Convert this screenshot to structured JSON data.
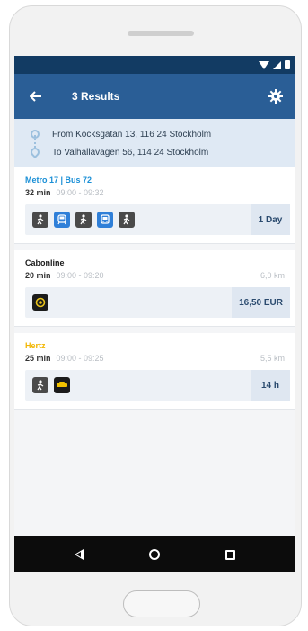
{
  "header": {
    "title": "3 Results"
  },
  "route": {
    "from": "From Kocksgatan 13, 116 24 Stockholm",
    "to": "To Valhallavägen 56, 114 24 Stockholm"
  },
  "results": [
    {
      "provider": "Metro 17 | Bus 72",
      "provider_color": "#1a8fd6",
      "duration": "32 min",
      "times": "09:00 - 09:32",
      "distance": "",
      "modes": [
        "walk-icon",
        "train-icon",
        "walk-icon",
        "bus-icon",
        "walk-icon"
      ],
      "price": "1 Day"
    },
    {
      "provider": "Cabonline",
      "provider_color": "#1b1b1b",
      "duration": "20 min",
      "times": "09:00 - 09:20",
      "distance": "6,0 km",
      "modes": [
        "taxi-icon"
      ],
      "price": "16,50 EUR"
    },
    {
      "provider": "Hertz",
      "provider_color": "#f2b705",
      "duration": "25 min",
      "times": "09:00 - 09:25",
      "distance": "5,5 km",
      "modes": [
        "walk-icon",
        "car-icon"
      ],
      "price": "14 h"
    }
  ],
  "colors": {
    "status_bar": "#123b63",
    "app_bar": "#2a5e96",
    "route_panel": "#dfe9f4",
    "transit_icon": "#2f7fd8"
  }
}
